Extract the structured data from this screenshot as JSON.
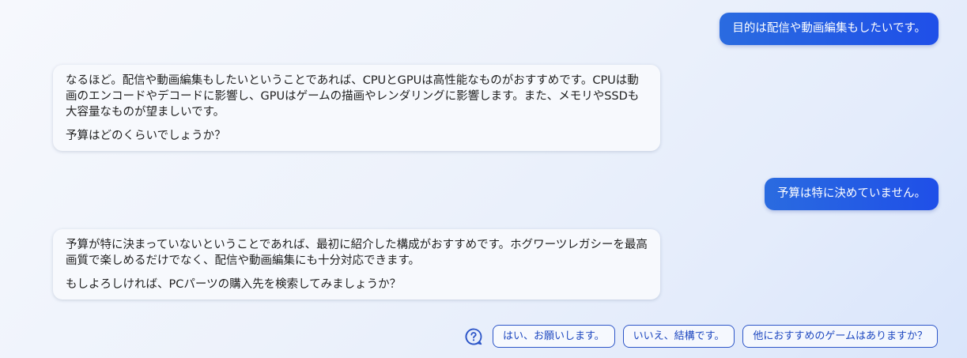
{
  "conversation": {
    "messages": [
      {
        "role": "user",
        "text": "目的は配信や動画編集もしたいです。"
      },
      {
        "role": "assistant",
        "paragraphs": [
          "なるほど。配信や動画編集もしたいということであれば、CPUとGPUは高性能なものがおすすめです。CPUは動画のエンコードやデコードに影響し、GPUはゲームの描画やレンダリングに影響します。また、メモリやSSDも大容量なものが望ましいです。",
          "予算はどのくらいでしょうか？"
        ]
      },
      {
        "role": "user",
        "text": "予算は特に決めていません。"
      },
      {
        "role": "assistant",
        "paragraphs": [
          "予算が特に決まっていないということであれば、最初に紹介した構成がおすすめです。ホグワーツレガシーを最高画質で楽しめるだけでなく、配信や動画編集にも十分対応できます。",
          "もしよろしければ、PCパーツの購入先を検索してみましょうか？"
        ]
      }
    ]
  },
  "suggestions": {
    "icon": "help-question-icon",
    "items": [
      "はい、お願いします。",
      "いいえ、結構です。",
      "他におすすめのゲームはありますか？"
    ]
  },
  "colors": {
    "user_bubble": "#2563e6",
    "chip_border": "#2c55c8",
    "chip_text": "#1e48c0"
  }
}
